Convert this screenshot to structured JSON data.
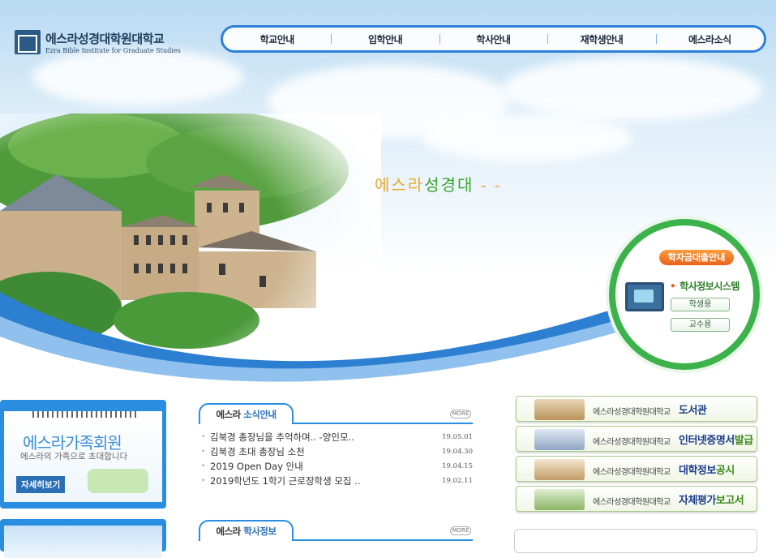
{
  "site": {
    "name_ko": "에스라성경대학원대학교",
    "name_en": "Ezra Bible Institute for Graduate Studies"
  },
  "nav": [
    "학교안내",
    "입학안내",
    "학사안내",
    "재학생안내",
    "에스라소식"
  ],
  "slogan": {
    "a": "에스라",
    "b": "성경대",
    "tail": "- -"
  },
  "widget": {
    "loan_label": "학자금대출안내",
    "system_label": "학사정보시스템",
    "student_label": "학생용",
    "faculty_label": "교수용"
  },
  "family": {
    "title": "에스라가족회원",
    "subtitle": "에스라의 가족으로 초대합니다",
    "more_label": "자세히보기"
  },
  "news": {
    "tab_a": "에스라 ",
    "tab_b": "소식안내",
    "more": "MORE",
    "items": [
      {
        "title": "김북경 총장님을 추억하며.. -양인모..",
        "date": "19.05.01"
      },
      {
        "title": "김북경 초대 총장님 소천",
        "date": "19.04.30"
      },
      {
        "title": "2019 Open Day 안내",
        "date": "19.04.15"
      },
      {
        "title": "2019학년도 1학기 근로장학생 모집 ..",
        "date": "19.02.11"
      }
    ]
  },
  "academic": {
    "tab_a": "에스라 ",
    "tab_b": "학사정보",
    "more": "MORE"
  },
  "quick_links": [
    {
      "prefix": "에스라성경대학원대학교",
      "blue": "도서관",
      "green": ""
    },
    {
      "prefix": "에스라성경대학원대학교",
      "blue": "인터넷증명서",
      "green": "발급"
    },
    {
      "prefix": "에스라성경대학원대학교",
      "blue": "대학정보",
      "green": "공시"
    },
    {
      "prefix": "에스라성경대학원대학교",
      "blue": "자체평가",
      "green": "보고서"
    }
  ]
}
